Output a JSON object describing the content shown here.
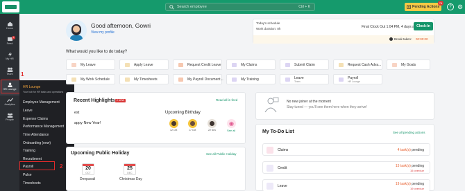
{
  "topbar": {
    "search_placeholder": "Search employee",
    "search_shortcut": "Ctrl + K",
    "pending_actions": "Pending Actions",
    "pending_count": "76",
    "help_icon": "?",
    "settings_icon": "⚙"
  },
  "sidebar": {
    "items": [
      {
        "label": "Home",
        "icon": "home-icon"
      },
      {
        "label": "Feed",
        "icon": "feed-icon",
        "badge": "5"
      },
      {
        "label": "My HR",
        "icon": "my-hr-icon"
      },
      {
        "label": "Team",
        "icon": "team-icon"
      },
      {
        "label": "HR Lounge",
        "icon": "hr-lounge-icon"
      },
      {
        "label": "Analytics",
        "icon": "analytics-icon"
      },
      {
        "label": "People",
        "icon": "people-icon"
      }
    ],
    "annotation_1": "1",
    "annotation_2": "2"
  },
  "hr_menu": {
    "title": "HR Lounge",
    "subtitle": "Your hub for HR tasks and operations",
    "items": [
      "Employee Management",
      "Leave",
      "Expense Claims",
      "Performance Management",
      "Time Attendance",
      "Onboarding (new)",
      "Training",
      "Recruitment",
      "Payroll",
      "Pulse",
      "Timesheets"
    ]
  },
  "greeting": {
    "text": "Good afternoon, Gowri",
    "view_profile": "View my profile"
  },
  "schedule": {
    "heading": "Today's schedule",
    "work_duration": "Work duration: 8h",
    "final_clock_out": "Final Clock Out 1:04 PM, 4 days ago",
    "clock_in": "Clock-In",
    "break_label": "Break taken:",
    "break_value": "00:00:00"
  },
  "quick_actions": {
    "question": "What would you like to do today?",
    "row1": [
      "My Leave",
      "Apply Leave",
      "Request Credit Leave",
      "My Claims",
      "Submit Claim",
      "Request Cash Adva...",
      "My Goals"
    ],
    "row2": [
      "My Work Schedule",
      "My Timesheets",
      "My Payroll Document...",
      "My Training"
    ],
    "leave_label": "Leave",
    "leave_sub": "Team",
    "payroll_label": "Payroll",
    "payroll_sub": "HR Lounge"
  },
  "highlights": {
    "title": "Recent Highlights",
    "new_tag": "2 NEW",
    "read_all": "Read all in feed",
    "left_header": "est",
    "left_text": "appy New Year!",
    "birthday_title": "Upcoming Birthday",
    "birthdays": [
      {
        "date": "12 Oct"
      },
      {
        "date": "17 Oct"
      },
      {
        "date": "22 Nov"
      }
    ],
    "see_all": "See all"
  },
  "joiner": {
    "line1": "No new joiner at the moment",
    "line2": "Stay tuned — you'll see them here when they arrive!"
  },
  "holiday": {
    "title": "Upcoming Public Holiday",
    "see_all": "See all Public Holiday",
    "items": [
      {
        "day": "20",
        "month": "OCT",
        "name": "Deepavali"
      },
      {
        "day": "25",
        "month": "DEC",
        "name": "Christmas Day"
      }
    ]
  },
  "todo": {
    "title": "My To-Do List",
    "see_all": "See all pending actions",
    "items": [
      {
        "label": "Claims",
        "count": "4 task(s)",
        "status": "pending",
        "overdue": ""
      },
      {
        "label": "Credit",
        "count": "15 task(s)",
        "status": "pending",
        "overdue": "15 overdue"
      },
      {
        "label": "Leave",
        "count": "19 task(s)",
        "status": "pending",
        "overdue": "19 overdue"
      }
    ]
  },
  "colors": {
    "brand": "#159a6c",
    "accent": "#f6c945",
    "alert": "#d93838"
  }
}
